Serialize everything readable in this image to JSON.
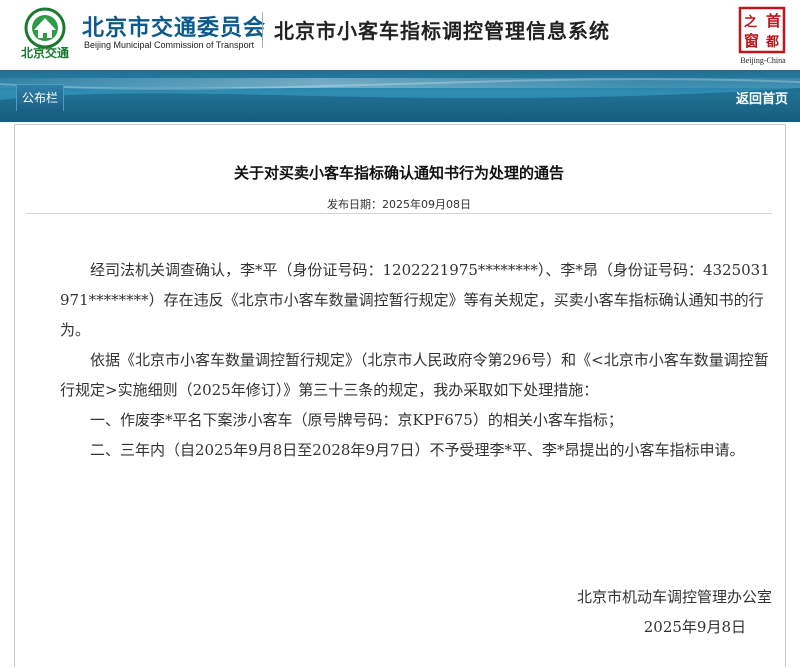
{
  "header": {
    "logo_caption": "北京交通",
    "org_name_cn": "北京市交通委员会",
    "org_name_en": "Beijing Municipal Commission of Transport",
    "system_title": "北京市小客车指标调控管理信息系统",
    "capital_logo_chars": [
      "首",
      "都",
      "之",
      "窗"
    ],
    "capital_logo_en": "Beijing-China"
  },
  "nav": {
    "bulletin_tab": "公布栏",
    "home_link": "返回首页"
  },
  "notice": {
    "title": "关于对买卖小客车指标确认通知书行为处理的通告",
    "publish_date": "发布日期：2025年09月08日",
    "paragraphs": [
      "经司法机关调查确认，李*平（身份证号码：1202221975********）、李*昂（身份证号码：4325031971********）存在违反《北京市小客车数量调控暂行规定》等有关规定，买卖小客车指标确认通知书的行为。",
      "依据《北京市小客车数量调控暂行规定》（北京市人民政府令第296号）和《<北京市小客车数量调控暂行规定>实施细则（2025年修订）》第三十三条的规定，我办采取如下处理措施：",
      "一、作废李*平名下案涉小客车（原号牌号码：京KPF675）的相关小客车指标；",
      "二、三年内（自2025年9月8日至2028年9月7日）不予受理李*平、李*昂提出的小客车指标申请。"
    ],
    "signature_org": "北京市机动车调控管理办公室",
    "signature_date": "2025年9月8日"
  },
  "colors": {
    "banner": "#2a84ad",
    "org_blue": "#0c5a8a",
    "logo_green": "#1a7a2e",
    "capital_red": "#c0141b"
  },
  "icons": {
    "commission_logo": "commission-emblem-icon",
    "capital_logo": "capital-window-icon"
  }
}
